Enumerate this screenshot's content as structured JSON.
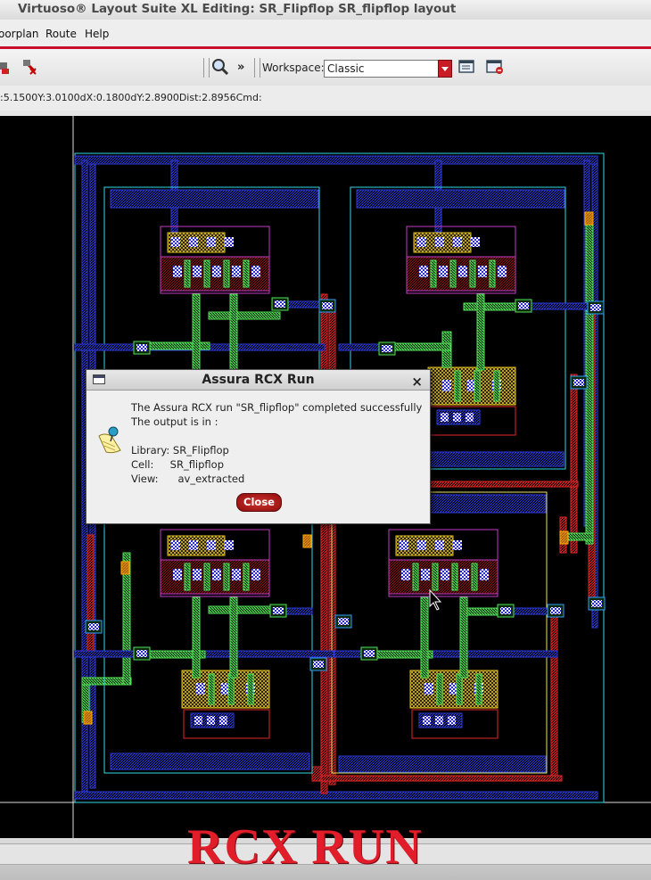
{
  "window": {
    "title": "Virtuoso® Layout Suite XL Editing: SR_Flipflop SR_flipflop layout"
  },
  "menu": {
    "items": [
      "oorplan",
      "Route",
      "Help"
    ]
  },
  "toolbar": {
    "chevron": "»",
    "workspace_label": "Workspace:",
    "workspace_value": "Classic",
    "icons": [
      "magnifier-icon",
      "workspace-save-icon",
      "workspace-view-icon"
    ]
  },
  "status": {
    "x": ":5.1500",
    "y": "Y:3.0100",
    "dx": "dX:0.1800",
    "dy": "dY:2.8900",
    "dist": "Dist:2.8956",
    "cmd": "Cmd:"
  },
  "dialog": {
    "title": "Assura RCX Run",
    "close_x": "×",
    "line1": "The Assura RCX run \"SR_flipflop\" completed successfully",
    "line2": "The output is in :",
    "library": "Library: SR_Flipflop",
    "cell": "Cell:     SR_flipflop",
    "view": "View:      av_extracted",
    "button": "Close"
  },
  "overlay_caption": "RCX RUN",
  "colors": {
    "metal1_blue": "#2f3bdb",
    "metal2_green": "#55e15a",
    "poly_red": "#e0282b",
    "nwell_cyan": "#33d8e8",
    "diff_magenta": "#c43bc4",
    "contact_yellow": "#f0d020",
    "accent_red": "#c8102e"
  }
}
